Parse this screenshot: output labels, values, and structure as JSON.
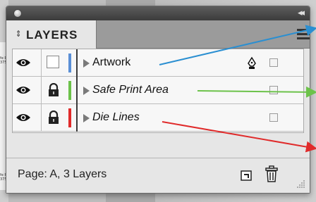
{
  "panel": {
    "title": "LAYERS",
    "tab_arrows": "⇕",
    "collapse_glyph": "◂◂"
  },
  "layers": [
    {
      "name": "Artwork",
      "color": "#5a8fd6",
      "visible": true,
      "locked": false,
      "italic": false,
      "has_pen": true
    },
    {
      "name": "Safe Print Area",
      "color": "#6cc24a",
      "visible": true,
      "locked": true,
      "italic": true,
      "has_pen": false
    },
    {
      "name": "Die Lines",
      "color": "#e02b2b",
      "visible": true,
      "locked": true,
      "italic": true,
      "has_pen": false
    }
  ],
  "footer": {
    "status": "Page: A, 3 Layers"
  },
  "background_note": {
    "line1": "fe P",
    "line2": "375"
  },
  "annotation_colors": {
    "blue": "#2b8fd1",
    "green": "#6cc24a",
    "red": "#e02b2b"
  }
}
